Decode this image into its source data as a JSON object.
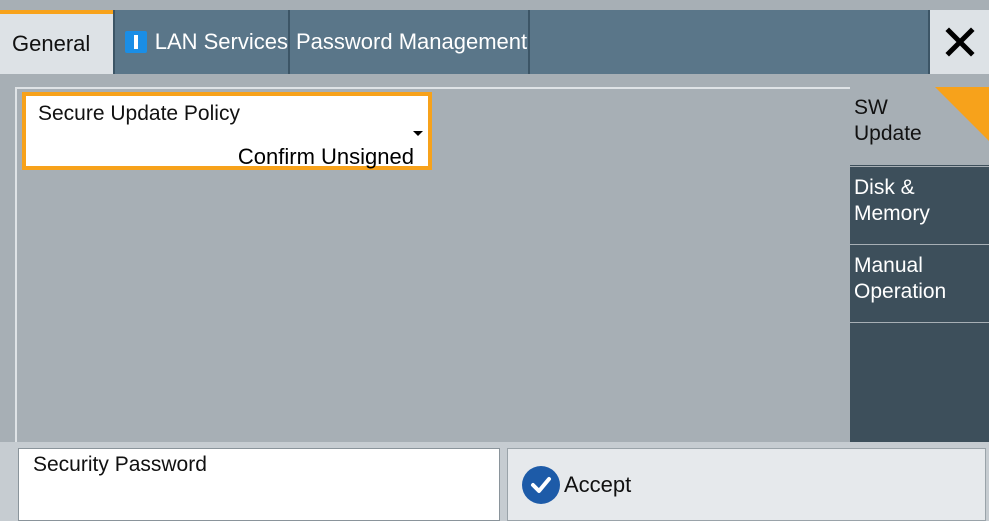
{
  "tabs": {
    "general": "General",
    "lan_services": "LAN Services",
    "password_management": "Password Management"
  },
  "policy": {
    "label": "Secure Update Policy",
    "value": "Confirm Unsigned"
  },
  "side_tabs": {
    "sw_update_line1": "SW",
    "sw_update_line2": "Update",
    "disk_line1": "Disk &",
    "disk_line2": "Memory",
    "manual_line1": "Manual",
    "manual_line2": "Operation"
  },
  "security_password": {
    "label": "Security Password"
  },
  "accept": {
    "label": "Accept"
  },
  "colors": {
    "accent": "#f7a21b",
    "tab_active_bg": "#dde2e6",
    "tab_inactive_bg": "#5a7689",
    "panel_bg": "#a7afb5",
    "side_tab_bg": "#3d4f5b",
    "check_icon": "#1d5ba8",
    "lan_indicator": "#1a8ee6"
  },
  "icons": {
    "close": "close-icon",
    "lan_indicator": "indicator-icon",
    "accept": "checkmark-icon"
  }
}
